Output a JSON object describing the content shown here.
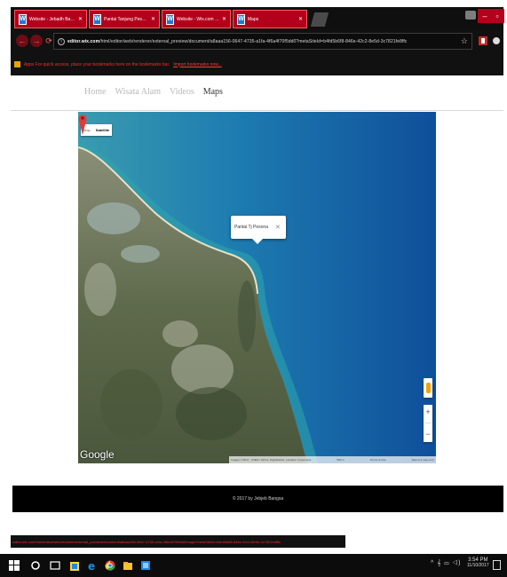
{
  "browser": {
    "tabs": [
      {
        "title": "Website - Jebadh Bangsa..."
      },
      {
        "title": "Pantai Tanjung Pesona - ..."
      },
      {
        "title": "Website - Wix.com | Website..."
      },
      {
        "title": "Maps"
      }
    ],
    "url_host": "editor.wix.com",
    "url_path": "/html/editor/web/renderer/external_preview/document/a8aaa156-0647-4735-a1fa-4f6a4f70f5dd0?metaSiteId=b4fd5b6f8-846e-42c2-8e5d-3c7821fe8ffc",
    "bookmark_notice": "Apps   For quick access, place your bookmarks here on the bookmarks bar.",
    "bookmark_link": "Import bookmarks now...",
    "status_url": "editor.wix.com/html/editor/web/renderer/external_preview/document/a8aaa156-0647-4735-a1fa-4f6a4f70f5dd0/maps?metaSiteId=b4fd5b6f8-846e-42c2-8e5d-3c7821fe8ffc"
  },
  "site": {
    "nav": [
      "Home",
      "Wisata Alam",
      "Videos",
      "Maps"
    ],
    "active_nav": "Maps",
    "footer": "© 2017 by Jebjeb Bangsa"
  },
  "map": {
    "type_options": [
      "Map",
      "Satellite"
    ],
    "selected_type": "Satellite",
    "info_window_title": "Pantai Tj Pesona",
    "logo": "Google",
    "zoom_in": "+",
    "zoom_out": "−",
    "attribution": "Imagery ©2017 , CNES / Airbus, DigitalGlobe, Landsat / Copernicus",
    "scale": "500 m",
    "terms": "Terms of Use",
    "report": "Report a map error",
    "colors": {
      "ocean": "#1565a8",
      "shallow": "#3fa7b6",
      "land": "#5a6648",
      "pin": "#e53935"
    }
  },
  "taskbar": {
    "time": "3:54 PM",
    "date": "11/10/2017",
    "tray": "^ 𝄞 ▭ ◁)"
  },
  "colors": {
    "chrome_bg": "#111111",
    "tab_red": "#b3001b",
    "footer_bg": "#000000"
  }
}
